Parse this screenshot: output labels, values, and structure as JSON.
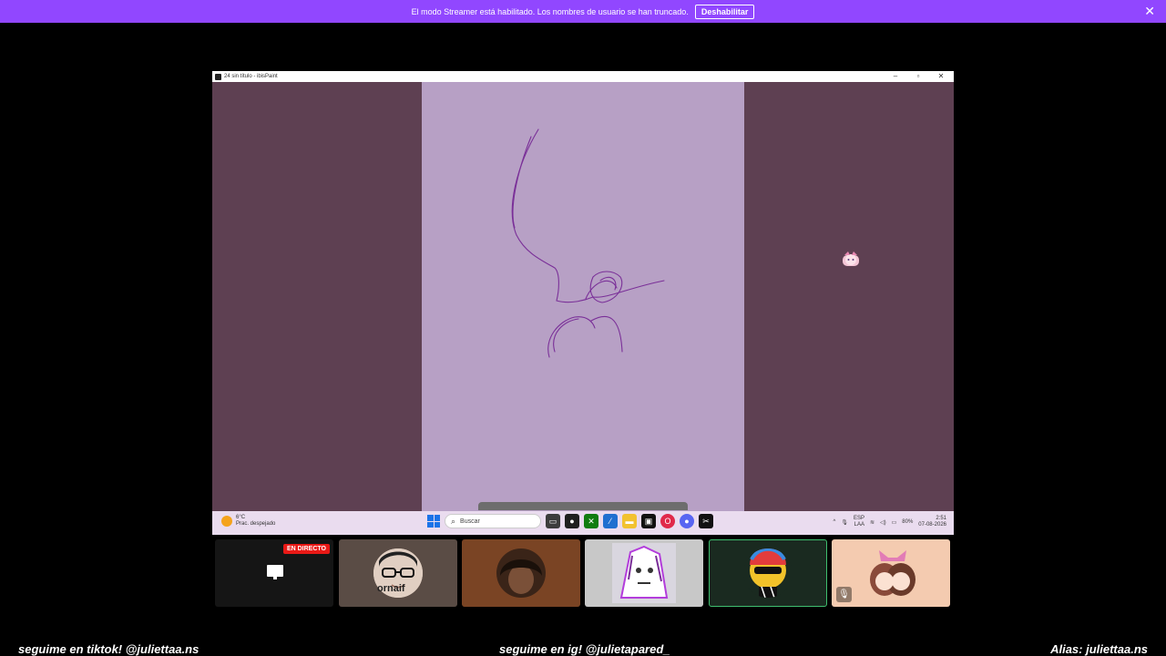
{
  "banner": {
    "message": "El modo Streamer está habilitado. Los nombres de usuario se han truncado.",
    "button": "Deshabilitar",
    "close_glyph": "✕",
    "color": "#9147ff"
  },
  "app_window": {
    "title": "24 sin título - ibisPaint",
    "minimize": "–",
    "maximize": "▫",
    "close": "✕"
  },
  "taskbar": {
    "weather_temp": "6°C",
    "weather_desc": "Prac. despejado",
    "search_placeholder": "Buscar",
    "lang_top": "ESP",
    "lang_bottom": "LAA",
    "battery": "80%",
    "time": "2:51",
    "date": "07-08-2026"
  },
  "tiles": [
    {
      "badge": "EN DIRECTO",
      "icon": "screen-share-icon"
    },
    {
      "overlay_text": "ornaif"
    },
    {},
    {},
    {
      "highlighted": true
    },
    {
      "muted": true
    }
  ],
  "footer": {
    "left": "seguime en tiktok!  @juliettaa.ns",
    "center": "seguime en ig!   @julietapared_",
    "right": "Alias: juliettaa.ns"
  }
}
